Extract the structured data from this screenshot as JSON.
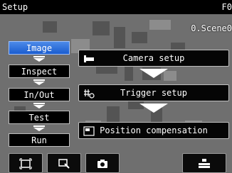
{
  "header": {
    "title": "Setup",
    "right_fragment": "F0",
    "scene": "0.Scene0"
  },
  "nav": {
    "items": [
      {
        "label": "Image",
        "active": true
      },
      {
        "label": "Inspect",
        "active": false
      },
      {
        "label": "In/Out",
        "active": false
      },
      {
        "label": "Test",
        "active": false
      },
      {
        "label": "Run",
        "active": false
      }
    ]
  },
  "setup": {
    "camera_label": "Camera setup",
    "trigger_label": "Trigger setup",
    "position_label": "Position compensation"
  },
  "toolbar": {
    "icons": [
      "fit-view-icon",
      "zoom-icon",
      "camera-icon",
      "layout-icon"
    ]
  },
  "colors": {
    "active_nav": "#2a6fe0",
    "title_bar": "#000000"
  }
}
